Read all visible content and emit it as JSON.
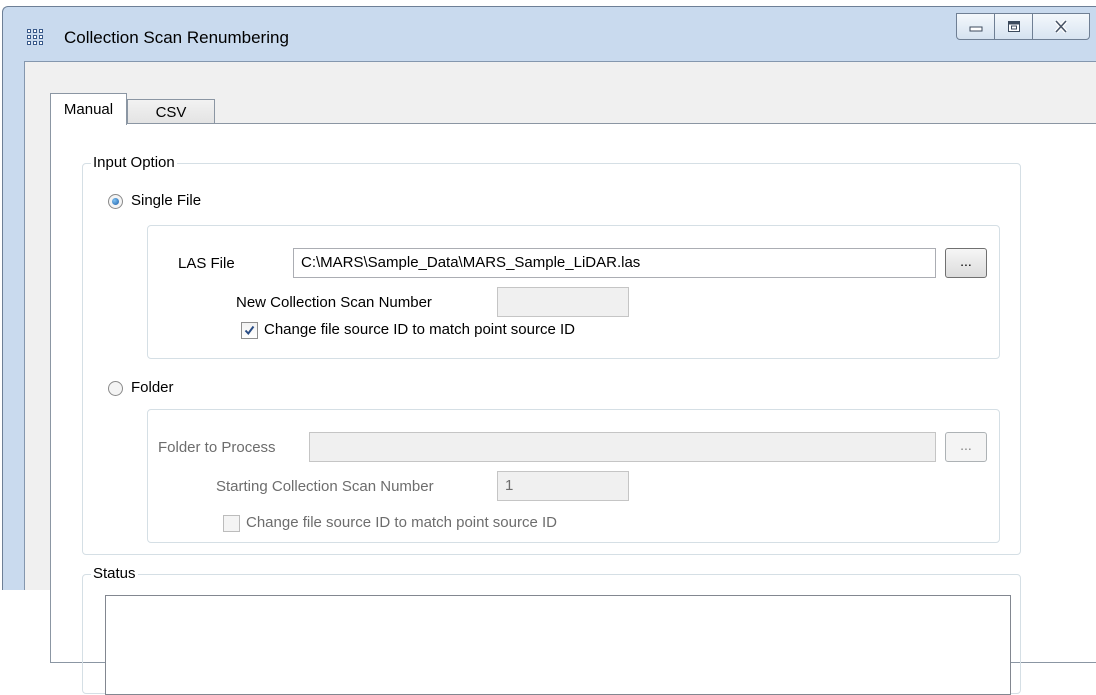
{
  "window": {
    "title": "Collection Scan Renumbering"
  },
  "tabs": [
    {
      "label": "Manual"
    },
    {
      "label": "CSV"
    }
  ],
  "input_option": {
    "legend": "Input Option",
    "single_file": {
      "label": "Single File",
      "selected": true,
      "las_file_label": "LAS File",
      "las_file_value": "C:\\MARS\\Sample_Data\\MARS_Sample_LiDAR.las",
      "browse_label": "...",
      "scan_number_label": "New Collection Scan Number",
      "scan_number_value": "",
      "change_id_label": "Change file source ID to match point source ID",
      "change_id_checked": true
    },
    "folder": {
      "label": "Folder",
      "selected": false,
      "folder_label": "Folder to Process",
      "folder_value": "",
      "browse_label": "...",
      "start_number_label": "Starting Collection Scan Number",
      "start_number_value": "1",
      "change_id_label": "Change file source ID to match point source ID",
      "change_id_checked": false
    }
  },
  "status": {
    "legend": "Status"
  }
}
